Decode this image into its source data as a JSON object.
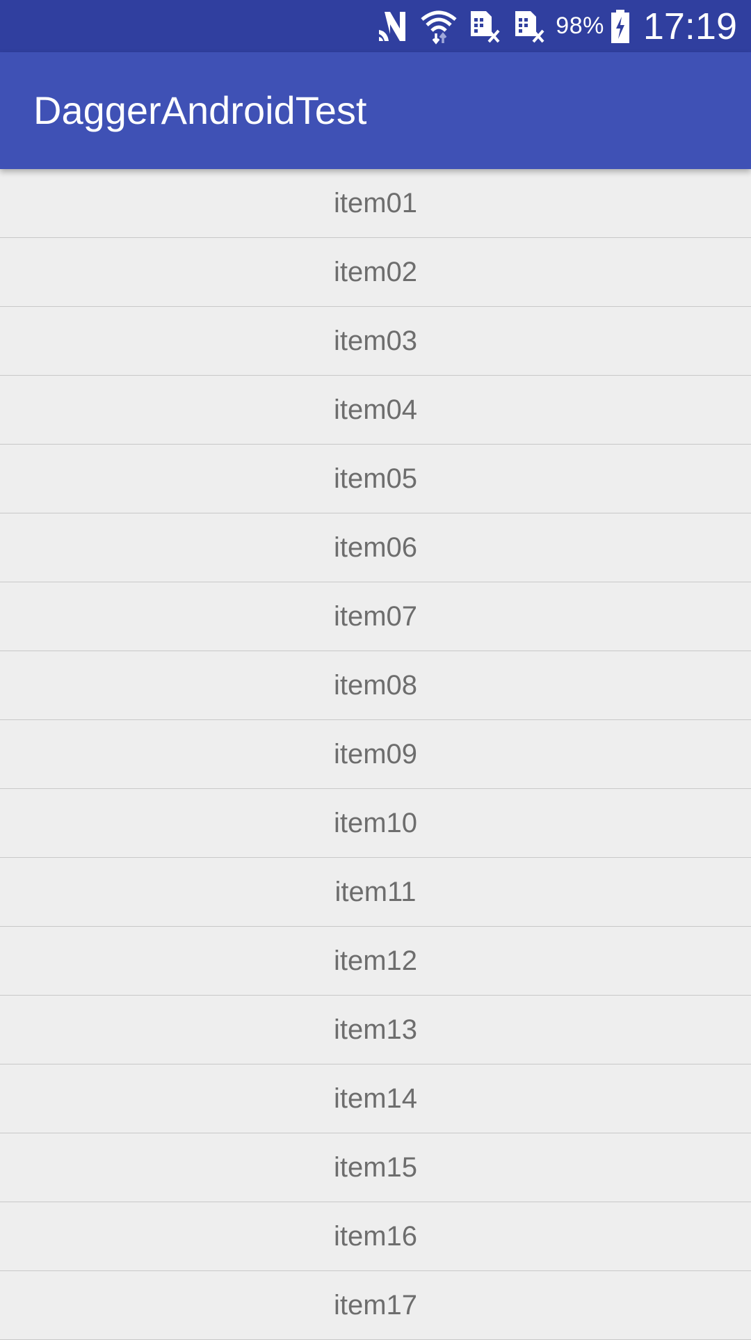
{
  "status_bar": {
    "icons": [
      "nfc-n-icon",
      "wifi-icon",
      "sim-no-signal-icon",
      "sim-no-signal-icon",
      "battery-charging-icon"
    ],
    "battery_percent": "98%",
    "time": "17:19",
    "colors": {
      "background": "#303f9f",
      "foreground": "#ffffff"
    }
  },
  "app_bar": {
    "title": "DaggerAndroidTest",
    "colors": {
      "background": "#3f51b5",
      "text": "#ffffff"
    }
  },
  "list": {
    "items": [
      {
        "label": "item01"
      },
      {
        "label": "item02"
      },
      {
        "label": "item03"
      },
      {
        "label": "item04"
      },
      {
        "label": "item05"
      },
      {
        "label": "item06"
      },
      {
        "label": "item07"
      },
      {
        "label": "item08"
      },
      {
        "label": "item09"
      },
      {
        "label": "item10"
      },
      {
        "label": "item11"
      },
      {
        "label": "item12"
      },
      {
        "label": "item13"
      },
      {
        "label": "item14"
      },
      {
        "label": "item15"
      },
      {
        "label": "item16"
      },
      {
        "label": "item17"
      }
    ],
    "colors": {
      "background": "#eeeeee",
      "divider": "#c8c8c8",
      "text": "#6d6d6d"
    }
  }
}
